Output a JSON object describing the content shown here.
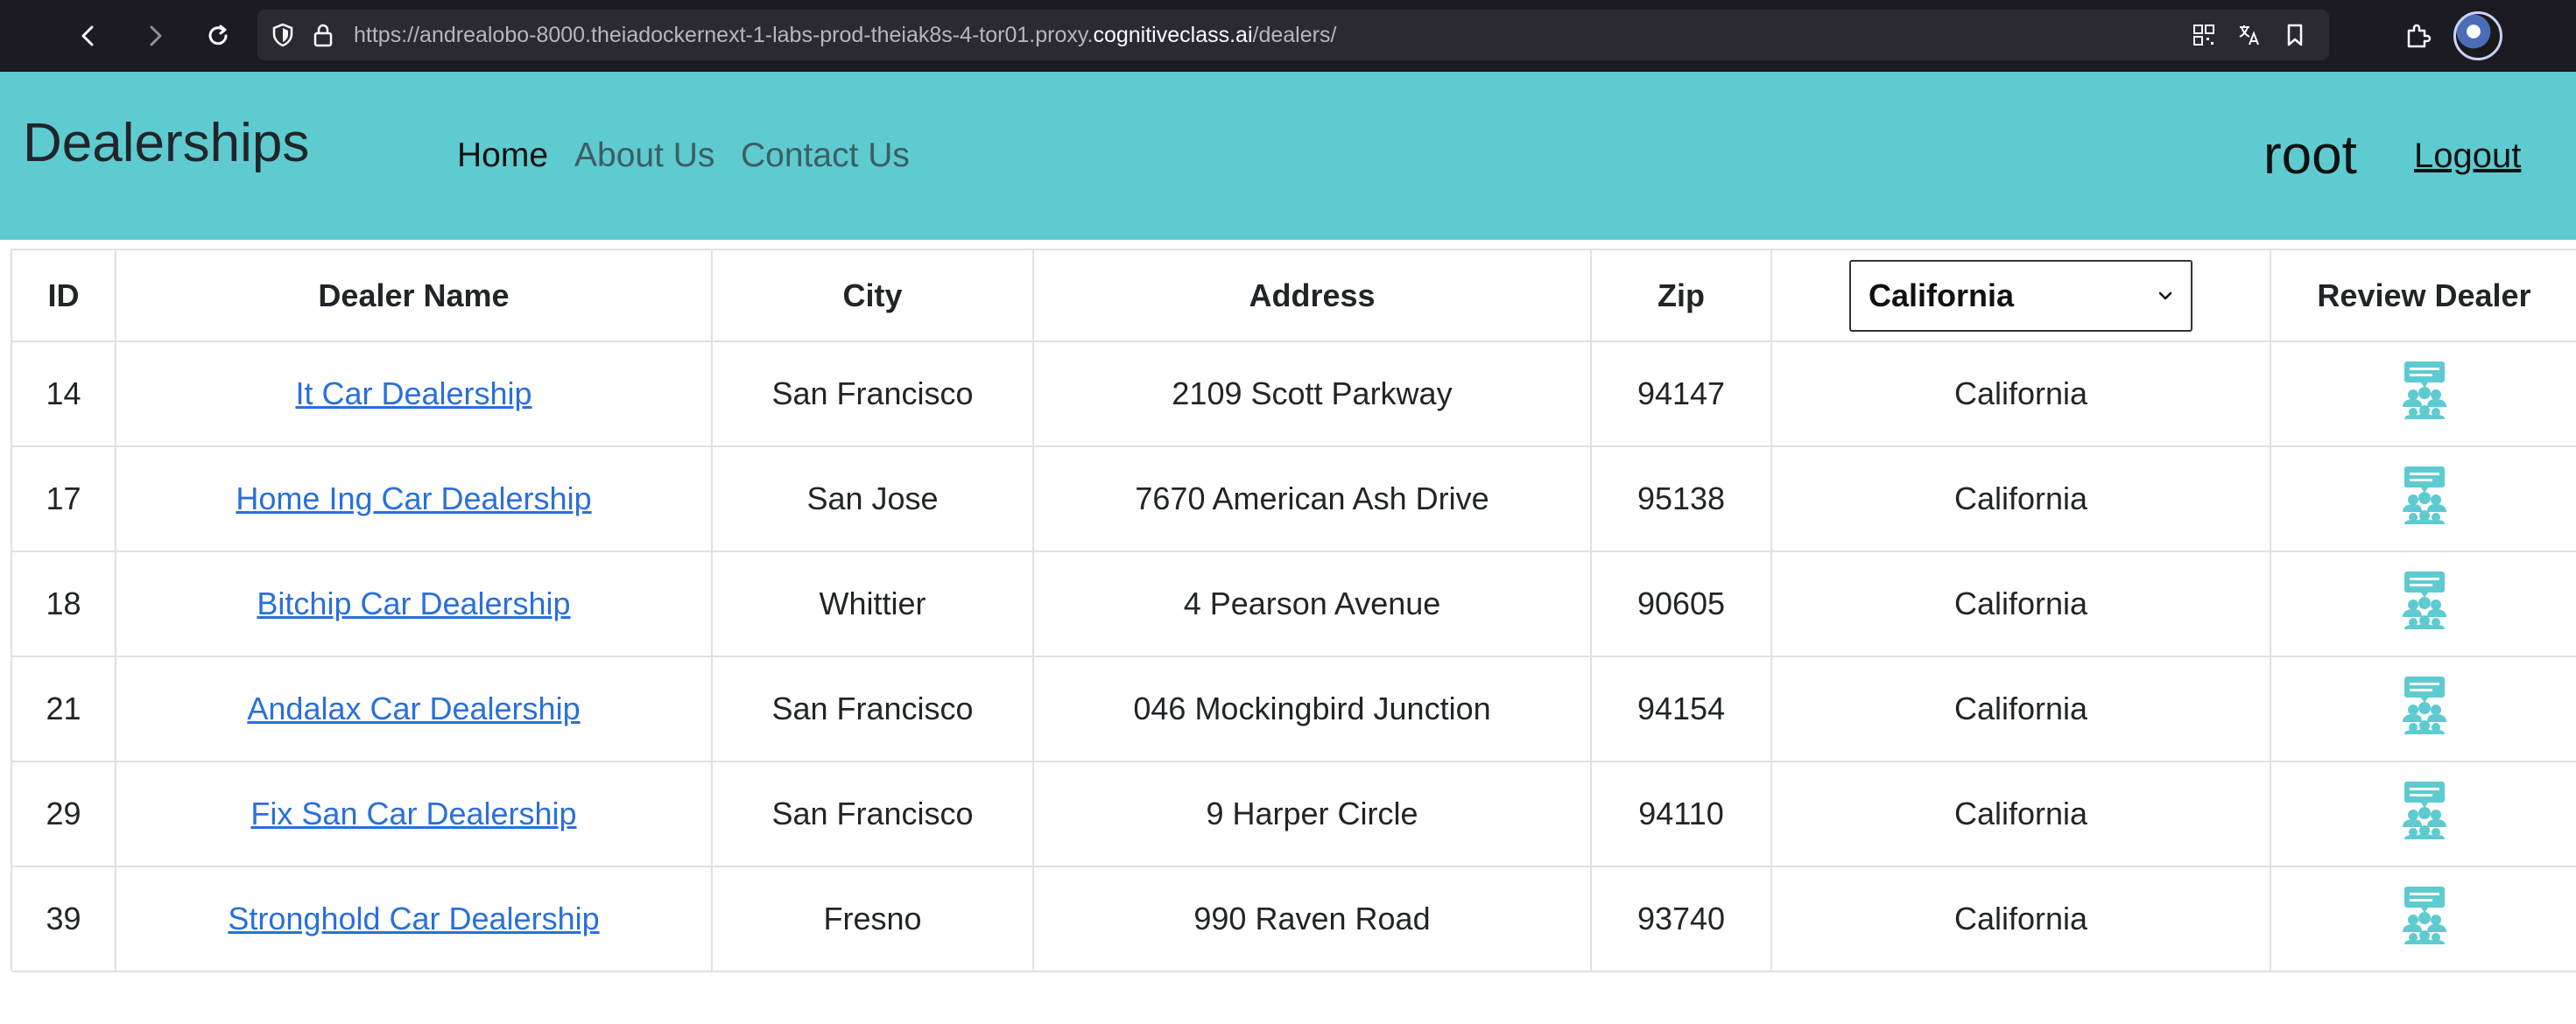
{
  "browser": {
    "url_prefix": "https://andrealobo-8000.theiadockernext-1-labs-prod-theiak8s-4-tor01.proxy.",
    "url_domain": "cognitiveclass.ai",
    "url_suffix": "/dealers/"
  },
  "navbar": {
    "brand": "Dealerships",
    "links": [
      "Home",
      "About Us",
      "Contact Us"
    ],
    "active_link": "Home",
    "user": "root",
    "logout": "Logout",
    "background_color": "#5ecbd0"
  },
  "table": {
    "headers": [
      "ID",
      "Dealer Name",
      "City",
      "Address",
      "Zip",
      "Review Dealer"
    ],
    "state_filter": "California",
    "rows": [
      {
        "id": "14",
        "name": "It Car Dealership",
        "city": "San Francisco",
        "address": "2109 Scott Parkway",
        "zip": "94147",
        "state": "California",
        "review_icon": "review-people-icon"
      },
      {
        "id": "17",
        "name": "Home Ing Car Dealership",
        "city": "San Jose",
        "address": "7670 American Ash Drive",
        "zip": "95138",
        "state": "California",
        "review_icon": "review-people-icon"
      },
      {
        "id": "18",
        "name": "Bitchip Car Dealership",
        "city": "Whittier",
        "address": "4 Pearson Avenue",
        "zip": "90605",
        "state": "California",
        "review_icon": "review-people-icon"
      },
      {
        "id": "21",
        "name": "Andalax Car Dealership",
        "city": "San Francisco",
        "address": "046 Mockingbird Junction",
        "zip": "94154",
        "state": "California",
        "review_icon": "review-people-icon"
      },
      {
        "id": "29",
        "name": "Fix San Car Dealership",
        "city": "San Francisco",
        "address": "9 Harper Circle",
        "zip": "94110",
        "state": "California",
        "review_icon": "review-people-icon"
      },
      {
        "id": "39",
        "name": "Stronghold Car Dealership",
        "city": "Fresno",
        "address": "990 Raven Road",
        "zip": "93740",
        "state": "California",
        "review_icon": "review-people-icon"
      }
    ],
    "link_color": "#2a6fdc",
    "icon_color": "#5ecbd0"
  }
}
